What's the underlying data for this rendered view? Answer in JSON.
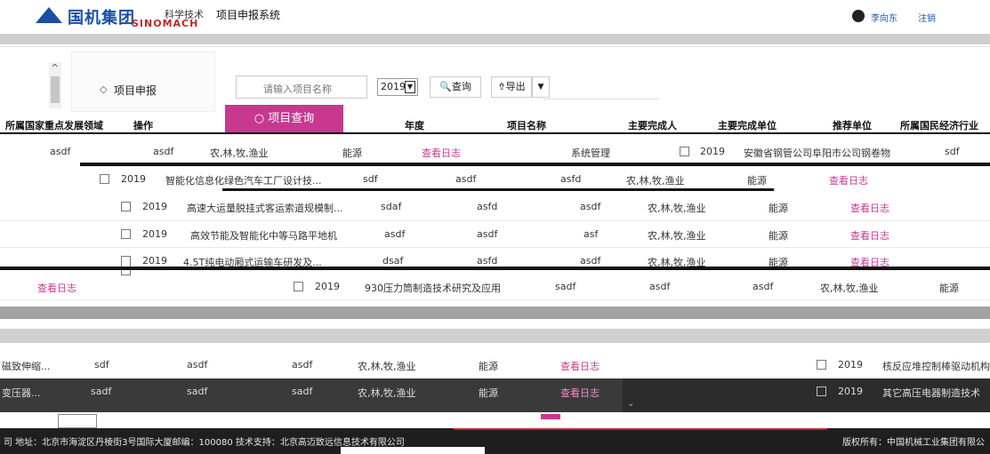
{
  "header": {
    "logo_cn": "国机集团",
    "logo_en": "SINOMACH",
    "slogan": "科学技术",
    "system_name": "项目申报系统",
    "user_name": "李向东",
    "logout": "注销"
  },
  "menu": {
    "apply": "项目申报",
    "query_tab": "项目查询"
  },
  "toolbar": {
    "search_placeholder": "请输入项目名称",
    "year": "2019",
    "query_btn": "查询",
    "export_btn": "导出"
  },
  "table": {
    "headers": [
      "所属国家重点发展领域",
      "操作",
      "年度",
      "项目名称",
      "主要完成人",
      "主要完成单位",
      "推荐单位",
      "所属国民经济行业"
    ],
    "rows": [
      {
        "year": "2019",
        "name": "智能化信息化绿色汽车工厂设计技...",
        "person": "sdf",
        "unit": "asdf",
        "recommend": "asfd",
        "industry": "农,林,牧,渔业",
        "field": "能源",
        "op": "查看日志"
      },
      {
        "year": "2019",
        "name": "高速大运量脱挂式客运索道规模制...",
        "person": "sdaf",
        "unit": "asfd",
        "recommend": "asdf",
        "industry": "农,林,牧,渔业",
        "field": "能源",
        "op": "查看日志"
      },
      {
        "year": "2019",
        "name": "高效节能及智能化中等马路平地机",
        "person": "asdf",
        "unit": "asdf",
        "recommend": "asf",
        "industry": "农,林,牧,渔业",
        "field": "能源",
        "op": "查看日志"
      },
      {
        "year": "2019",
        "name": "4.5T纯电动厢式运输车研发及...",
        "person": "dsaf",
        "unit": "asfd",
        "recommend": "asdf",
        "industry": "农,林,牧,渔业",
        "field": "能源",
        "op": "查看日志"
      },
      {
        "year": "2019",
        "name": "930压力筒制造技术研究及应用",
        "person": "sadf",
        "unit": "asdf",
        "recommend": "asdf",
        "industry": "农,林,牧,渔业",
        "field": "能源",
        "op": "查看日志"
      },
      {
        "year": "2019",
        "name": "核反应堆控制棒驱动机构...",
        "person": "sdf",
        "unit": "asdf",
        "recommend": "asdf",
        "industry": "农,林,牧,渔业",
        "field": "能源",
        "op": "查看日志"
      }
    ],
    "fragment_row": {
      "a": "asdf",
      "b": "asdf",
      "industry": "农,林,牧,渔业",
      "field": "能源",
      "op": "查看日志",
      "menu": "系统管理",
      "year": "2019",
      "unit": "安徽省钢管公司阜阳市公司钢卷物",
      "tail": "sdf"
    },
    "fragment_row2": {
      "name": "磁致伸缩...",
      "a": "sdf",
      "b": "asdf",
      "c": "asdf",
      "industry": "农,林,牧,渔业",
      "field": "能源",
      "op": "查看日志",
      "year": "2019",
      "name2": "核反应堆控制棒驱动机构"
    },
    "fragment_row3": {
      "name": "变压器...",
      "a": "sadf",
      "b": "sadf",
      "c": "sadf",
      "industry": "农,林,牧,渔业",
      "field": "能源",
      "op": "查看日志",
      "year": "2019",
      "name2": "其它高压电器制造技术"
    },
    "left_link": "查看日志"
  },
  "footer": {
    "left": "司 地址：北京市海淀区丹棱街3号国际大厦邮编：100080 技术支持：北京高迈致远信息技术有限公司",
    "right": "版权所有：中国机械工业集团有限公"
  },
  "colors": {
    "accent": "#c8388f",
    "brand_blue": "#1a4fa3",
    "brand_red": "#c0272d"
  }
}
